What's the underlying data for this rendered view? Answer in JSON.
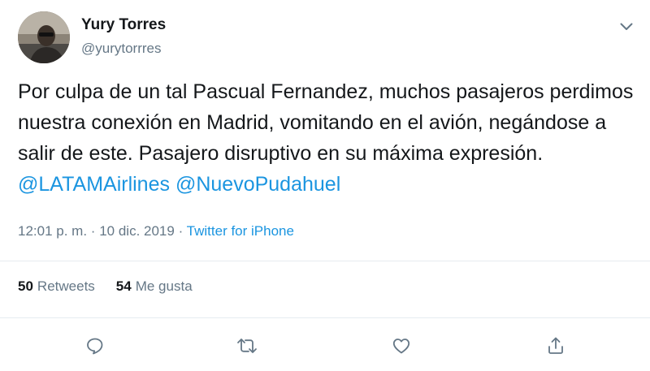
{
  "tweet": {
    "author_name": "Yury Torres",
    "author_handle": "@yurytorrres",
    "text_plain": "Por culpa de un tal Pascual Fernandez, muchos pasajeros perdimos nuestra conexión en Madrid, vomitando en el avión, negándose a salir de este. Pasajero disruptivo en su máxima expresión.",
    "mentions": [
      "@LATAMAirlines",
      "@NuevoPudahuel"
    ],
    "time": "12:01 p. m.",
    "separator": "·",
    "date": "10 dic. 2019",
    "source": "Twitter for iPhone"
  },
  "stats": {
    "retweets_count": "50",
    "retweets_label": "Retweets",
    "likes_count": "54",
    "likes_label": "Me gusta"
  },
  "icons": {
    "caret": "chevron-down-icon",
    "reply": "reply-icon",
    "retweet": "retweet-icon",
    "like": "heart-icon",
    "share": "share-icon"
  },
  "colors": {
    "text": "#14171a",
    "secondary": "#657786",
    "link": "#1b95e0",
    "icon": "#657786",
    "divider": "#e6ecf0"
  }
}
